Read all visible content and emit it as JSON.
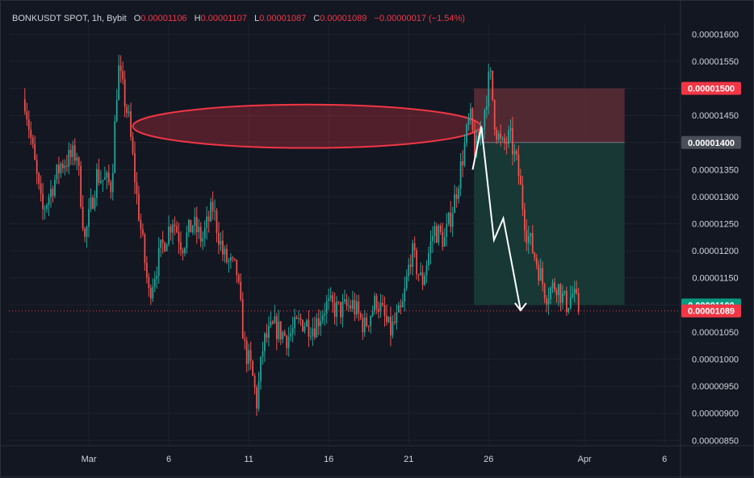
{
  "header": {
    "symbol": "BONKUSDT SPOT, 1h, Bybit",
    "o_label": "O",
    "o_value": "0.00001106",
    "h_label": "H",
    "h_value": "0.00001107",
    "l_label": "L",
    "l_value": "0.00001087",
    "c_label": "C",
    "c_value": "0.00001089",
    "change": "−0.00000017 (−1.54%)"
  },
  "colors": {
    "background": "#131722",
    "up": "#26a69a",
    "down": "#ef5350",
    "stop_zone": "#5c2d36",
    "target_zone": "#173a36",
    "ellipse": "#f23645",
    "arrow": "#ffffff",
    "last_price": "#f23645",
    "target_tag": "#089981",
    "entry_tag": "#4a4e59"
  },
  "chart_data": {
    "type": "candlestick",
    "symbol": "BONKUSDT",
    "timeframe": "1h",
    "exchange": "Bybit",
    "ylim": [
      8.4e-06,
      1.62e-05
    ],
    "xlim": [
      "2025-02-24",
      "2025-04-07"
    ],
    "y_ticks": [
      "0.00001600",
      "0.00001550",
      "0.00001500",
      "0.00001450",
      "0.00001400",
      "0.00001350",
      "0.00001300",
      "0.00001250",
      "0.00001200",
      "0.00001150",
      "0.00001100",
      "0.00001050",
      "0.00001000",
      "0.00000950",
      "0.00000900",
      "0.00000850"
    ],
    "x_ticks": [
      {
        "label": "Mar",
        "date": "2025-03-01"
      },
      {
        "label": "6",
        "date": "2025-03-06"
      },
      {
        "label": "11",
        "date": "2025-03-11"
      },
      {
        "label": "16",
        "date": "2025-03-16"
      },
      {
        "label": "21",
        "date": "2025-03-21"
      },
      {
        "label": "26",
        "date": "2025-03-26"
      },
      {
        "label": "Apr",
        "date": "2025-04-01"
      },
      {
        "label": "6",
        "date": "2025-04-06"
      }
    ],
    "price_path": [
      [
        "2025-02-25T00:00",
        1.48e-05
      ],
      [
        "2025-02-26T02:00",
        1.27e-05
      ],
      [
        "2025-02-27T06:00",
        1.36e-05
      ],
      [
        "2025-02-28T06:00",
        1.38e-05
      ],
      [
        "2025-02-28T18:00",
        1.22e-05
      ],
      [
        "2025-03-01T12:00",
        1.34e-05
      ],
      [
        "2025-03-02T10:00",
        1.32e-05
      ],
      [
        "2025-03-02T20:00",
        1.54e-05
      ],
      [
        "2025-03-03T12:00",
        1.44e-05
      ],
      [
        "2025-03-04T00:00",
        1.3e-05
      ],
      [
        "2025-03-04T18:00",
        1.12e-05
      ],
      [
        "2025-03-05T12:00",
        1.2e-05
      ],
      [
        "2025-03-06T06:00",
        1.26e-05
      ],
      [
        "2025-03-06T20:00",
        1.21e-05
      ],
      [
        "2025-03-07T12:00",
        1.25e-05
      ],
      [
        "2025-03-08T02:00",
        1.22e-05
      ],
      [
        "2025-03-08T18:00",
        1.28e-05
      ],
      [
        "2025-03-09T10:00",
        1.19e-05
      ],
      [
        "2025-03-10T06:00",
        1.16e-05
      ],
      [
        "2025-03-10T18:00",
        1.02e-05
      ],
      [
        "2025-03-11T04:00",
        9.8e-06
      ],
      [
        "2025-03-11T12:00",
        9.2e-06
      ],
      [
        "2025-03-11T22:00",
        1.03e-05
      ],
      [
        "2025-03-12T14:00",
        1.06e-05
      ],
      [
        "2025-03-13T10:00",
        1.04e-05
      ],
      [
        "2025-03-14T06:00",
        1.07e-05
      ],
      [
        "2025-03-15T02:00",
        1.06e-05
      ],
      [
        "2025-03-15T20:00",
        1.1e-05
      ],
      [
        "2025-03-16T16:00",
        1.09e-05
      ],
      [
        "2025-03-17T12:00",
        1.1e-05
      ],
      [
        "2025-03-18T06:00",
        1.06e-05
      ],
      [
        "2025-03-19T00:00",
        1.11e-05
      ],
      [
        "2025-03-19T20:00",
        1.05e-05
      ],
      [
        "2025-03-20T14:00",
        1.09e-05
      ],
      [
        "2025-03-21T04:00",
        1.2e-05
      ],
      [
        "2025-03-21T20:00",
        1.14e-05
      ],
      [
        "2025-03-22T14:00",
        1.24e-05
      ],
      [
        "2025-03-23T06:00",
        1.22e-05
      ],
      [
        "2025-03-23T22:00",
        1.3e-05
      ],
      [
        "2025-03-24T10:00",
        1.38e-05
      ],
      [
        "2025-03-24T20:00",
        1.45e-05
      ],
      [
        "2025-03-25T04:00",
        1.38e-05
      ],
      [
        "2025-03-25T14:00",
        1.43e-05
      ],
      [
        "2025-03-26T02:00",
        1.53e-05
      ],
      [
        "2025-03-26T10:00",
        1.43e-05
      ],
      [
        "2025-03-26T20:00",
        1.39e-05
      ],
      [
        "2025-03-27T08:00",
        1.41e-05
      ],
      [
        "2025-03-27T20:00",
        1.35e-05
      ],
      [
        "2025-03-28T08:00",
        1.24e-05
      ],
      [
        "2025-03-29T00:00",
        1.18e-05
      ],
      [
        "2025-03-29T14:00",
        1.12e-05
      ],
      [
        "2025-03-30T06:00",
        1.14e-05
      ],
      [
        "2025-03-30T20:00",
        1.1e-05
      ],
      [
        "2025-03-31T06:00",
        1.12e-05
      ],
      [
        "2025-03-31T16:00",
        1.09e-05
      ]
    ],
    "position": {
      "side": "short",
      "start": "2025-03-25T02:00",
      "end": "2025-04-03T12:00",
      "stop": 1.5e-05,
      "entry": 1.4e-05,
      "target": 1.1e-05,
      "stop_label": "0.00001500",
      "entry_label": "0.00001400",
      "target_label": "0.00001100"
    },
    "last_price": {
      "value": 1.089e-05,
      "label": "0.00001089"
    },
    "ellipse": {
      "x1": "2025-03-03T18:00",
      "x2": "2025-03-25T12:00",
      "y_high": 1.47e-05,
      "y_low": 1.39e-05
    },
    "arrow_path": [
      [
        "2025-03-25T00:00",
        1.35e-05
      ],
      [
        "2025-03-25T13:00",
        1.43e-05
      ],
      [
        "2025-03-26T08:00",
        1.22e-05
      ],
      [
        "2025-03-26T22:00",
        1.26e-05
      ],
      [
        "2025-03-28T00:00",
        1.09e-05
      ]
    ]
  }
}
